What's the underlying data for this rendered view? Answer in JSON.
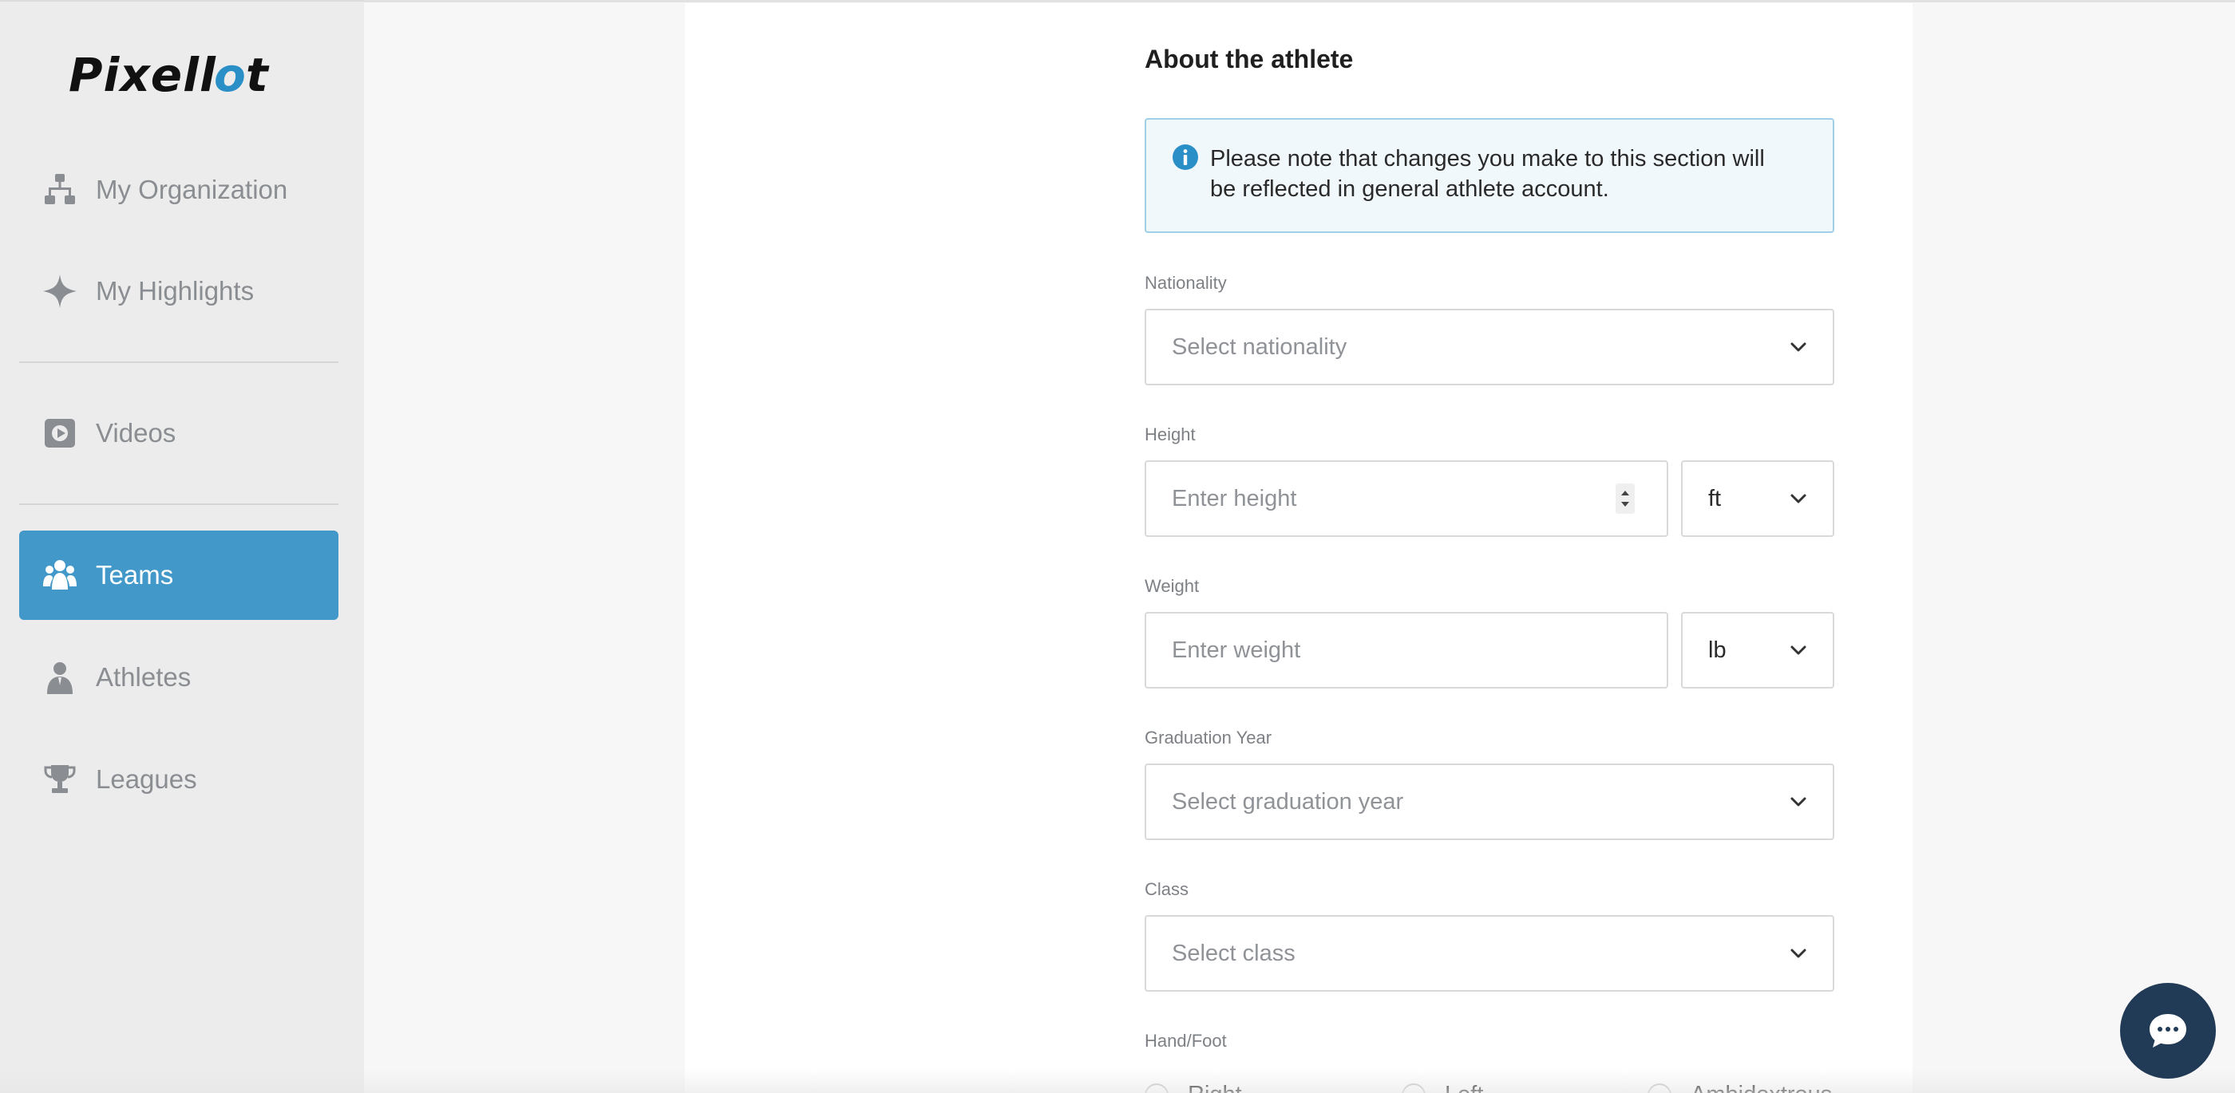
{
  "brand": {
    "name": "Pixellot"
  },
  "sidebar": {
    "items": [
      {
        "label": "My Organization",
        "icon": "org-chart-icon",
        "active": false
      },
      {
        "label": "My Highlights",
        "icon": "sparkle-icon",
        "active": false
      },
      {
        "label": "Videos",
        "icon": "video-play-icon",
        "active": false
      },
      {
        "label": "Teams",
        "icon": "team-icon",
        "active": true
      },
      {
        "label": "Athletes",
        "icon": "athlete-icon",
        "active": false
      },
      {
        "label": "Leagues",
        "icon": "trophy-icon",
        "active": false
      }
    ]
  },
  "form": {
    "section_title": "About the athlete",
    "notice": "Please note that changes you make to this section will be reflected in general athlete account.",
    "nationality": {
      "label": "Nationality",
      "placeholder": "Select nationality"
    },
    "height": {
      "label": "Height",
      "placeholder": "Enter height",
      "unit": "ft"
    },
    "weight": {
      "label": "Weight",
      "placeholder": "Enter weight",
      "unit": "lb"
    },
    "graduation_year": {
      "label": "Graduation Year",
      "placeholder": "Select graduation year"
    },
    "class": {
      "label": "Class",
      "placeholder": "Select class"
    },
    "hand_foot": {
      "label": "Hand/Foot",
      "options": [
        "Right",
        "Left",
        "Ambidextrous"
      ]
    }
  },
  "colors": {
    "accent": "#4299c9",
    "info_bg": "#f1f8fc",
    "info_border": "#9fd0e6",
    "chat_bg": "#213a55"
  }
}
